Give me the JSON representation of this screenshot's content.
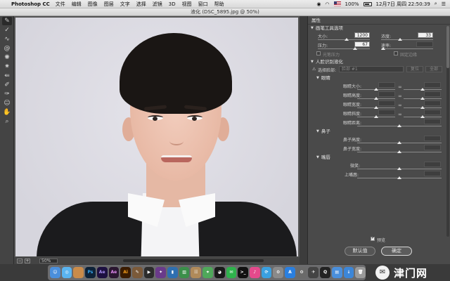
{
  "menubar": {
    "app_name": "Photoshop CC",
    "menus": [
      "文件",
      "编辑",
      "图像",
      "图层",
      "文字",
      "选择",
      "滤镜",
      "3D",
      "视图",
      "窗口",
      "帮助"
    ],
    "clock": "12月7日 周四  22:50:39",
    "battery_pct": "100%"
  },
  "dialog": {
    "title": "液化 (DSC_5895.jpg @ 50%)"
  },
  "canvas": {
    "zoom": "50%"
  },
  "panel": {
    "title": "属性",
    "brush_section": "画笔工具选项",
    "size_label": "大小:",
    "size_value": "1200",
    "density_label": "浓度:",
    "density_value": "33",
    "pressure_label": "压力:",
    "pressure_value": "67",
    "rate_label": "速率:",
    "light_pressure": "光笔压力",
    "pin_edges": "固定边缘",
    "face_section": "人脸识别液化",
    "select_face_label": "选择脸部:",
    "select_face_value": "脸部 #1",
    "reset": "复位",
    "all": "全部",
    "eyes_section": "眼睛",
    "eye_size": "眼睛大小:",
    "eye_height": "眼睛高度:",
    "eye_width": "眼睛宽度:",
    "eye_tilt": "眼睛斜度:",
    "eye_distance": "眼睛距离:",
    "nose_section": "鼻子",
    "nose_height": "鼻子高度:",
    "nose_width": "鼻子宽度:",
    "mouth_section": "嘴唇",
    "smile": "微笑:",
    "upper_lip": "上嘴唇:",
    "preview": "预览",
    "default_btn": "默认值",
    "ok_btn": "确定"
  },
  "watermark": {
    "text": "津门网"
  },
  "dock_icons": [
    "finder",
    "safari",
    "photos",
    "ps",
    "ae",
    "ai-ae",
    "ai",
    "script",
    "video",
    "movie",
    "bars",
    "chart",
    "contacts",
    "maps",
    "qq",
    "wechat",
    "terminal",
    "itunes",
    "sync",
    "settings",
    "appstore",
    "system-prefs",
    "launchpad",
    "quicktime",
    "finder2",
    "downloads",
    "trash"
  ]
}
